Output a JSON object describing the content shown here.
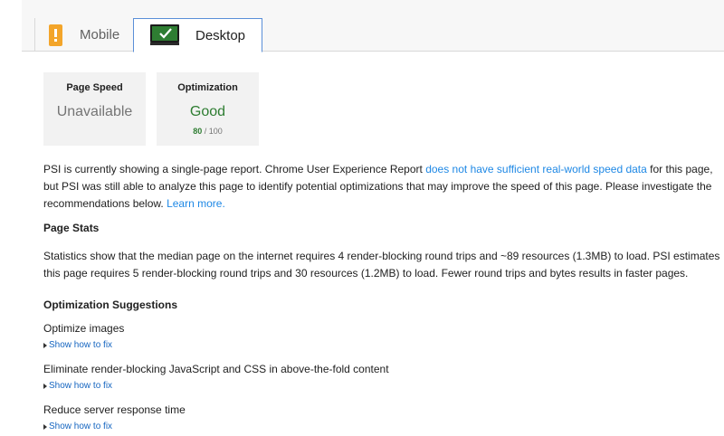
{
  "tabs": {
    "mobile_label": "Mobile",
    "desktop_label": "Desktop"
  },
  "scores": {
    "page_speed": {
      "title": "Page Speed",
      "value": "Unavailable"
    },
    "optimization": {
      "title": "Optimization",
      "value": "Good",
      "score": "80",
      "max": " / 100"
    }
  },
  "intro": {
    "text_1": "PSI is currently showing a single-page report. Chrome User Experience Report ",
    "link_1": "does not have sufficient real-world speed data",
    "text_2": " for this page, but PSI was still able to analyze this page to identify potential optimizations that may improve the speed of this page. Please investigate the recommendations below. ",
    "link_2": "Learn more."
  },
  "page_stats": {
    "heading": "Page Stats",
    "text": "Statistics show that the median page on the internet requires 4 render-blocking round trips and ~89 resources (1.3MB) to load. PSI estimates this page requires 5 render-blocking round trips and 30 resources (1.2MB) to load. Fewer round trips and bytes results in faster pages."
  },
  "suggestions": {
    "heading": "Optimization Suggestions",
    "items": [
      {
        "title": "Optimize images",
        "link": "Show how to fix"
      },
      {
        "title": "Eliminate render-blocking JavaScript and CSS in above-the-fold content",
        "link": "Show how to fix"
      },
      {
        "title": "Reduce server response time",
        "link": "Show how to fix"
      }
    ]
  },
  "colors": {
    "good": "#2e7d32",
    "link": "#1e88e5",
    "warning": "#f3a52a",
    "active_tab_border": "#5a8fd8"
  },
  "icons": {
    "mobile": "phone-warning-icon",
    "desktop": "monitor-check-icon"
  }
}
